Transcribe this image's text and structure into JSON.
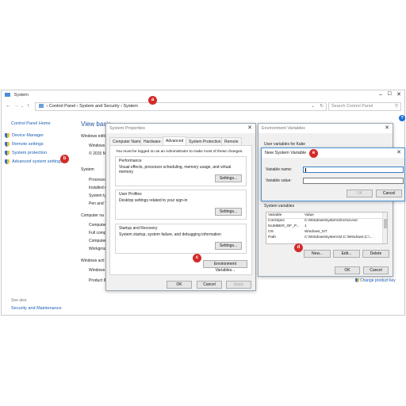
{
  "system_window": {
    "title": "System",
    "breadcrumb": [
      "Control Panel",
      "System and Security",
      "System"
    ],
    "search_placeholder": "Search Control Panel",
    "sidebar": {
      "home": "Control Panel Home",
      "items": [
        "Device Manager",
        "Remote settings",
        "System protection",
        "Advanced system settings"
      ],
      "see_also": "See also",
      "see_also_item": "Security and Maintenance"
    },
    "main": {
      "heading": "View basic",
      "windows_edition": "Windows editi",
      "edition_lines": [
        "Windows",
        "© 2015 M"
      ],
      "system_heading": "System",
      "system_lines": [
        "Processor",
        "Installed m",
        "System typ",
        "Pen and T"
      ],
      "computer_heading": "Computer na",
      "computer_lines": [
        "Computer",
        "Full comp",
        "Computer",
        "Workgrou"
      ],
      "activation_heading": "Windows acti",
      "activation_lines": [
        "Windows",
        "Product ID"
      ],
      "change_key": "Change product key"
    }
  },
  "system_properties": {
    "title": "System Properties",
    "tabs": [
      "Computer Name",
      "Hardware",
      "Advanced",
      "System Protection",
      "Remote"
    ],
    "admin_note": "You must be logged on as an Administrator to make most of these changes.",
    "performance": {
      "title": "Performance",
      "desc": "Visual effects, processor scheduling, memory usage, and virtual memory",
      "button": "Settings..."
    },
    "user_profiles": {
      "title": "User Profiles",
      "desc": "Desktop settings related to your sign-in",
      "button": "Settings..."
    },
    "startup": {
      "title": "Startup and Recovery",
      "desc": "System startup, system failure, and debugging information",
      "button": "Settings..."
    },
    "env_button": "Environment Variables...",
    "ok": "OK",
    "cancel": "Cancel",
    "apply": "Apply"
  },
  "environment_variables": {
    "title": "Environment Variables",
    "user_vars_label": "User variables for Katie",
    "system_vars_label": "System variables",
    "columns": [
      "Variable",
      "Value"
    ],
    "rows": [
      [
        "ComSpec",
        "C:\\Windows\\system32\\cmd.exe"
      ],
      [
        "NUMBER_OF_P...",
        "1"
      ],
      [
        "OS",
        "Windows_NT"
      ],
      [
        "Path",
        "C:\\Windows\\system32;C:\\Windows;C:\\..."
      ]
    ],
    "new_button": "New...",
    "edit_button": "Edit...",
    "delete_button": "Delete",
    "ok": "OK",
    "cancel": "Cancel"
  },
  "new_system_variable": {
    "title": "New System Variable",
    "name_label": "Variable name:",
    "value_label": "Variable value:",
    "ok": "OK",
    "cancel": "Cancel"
  },
  "badges": [
    "a",
    "b",
    "c",
    "d",
    "e"
  ],
  "colors": {
    "badge": "#d42a2a",
    "link": "#1a5fb4",
    "heading": "#1e4e9c"
  }
}
